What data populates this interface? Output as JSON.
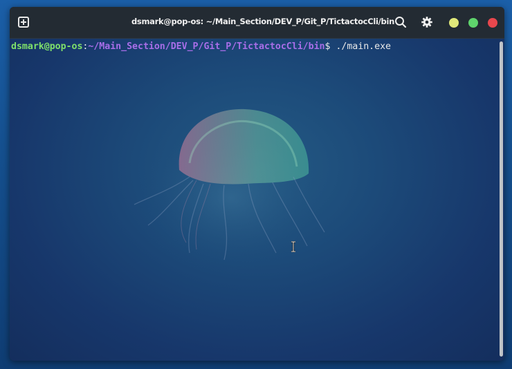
{
  "window": {
    "title": "dsmark@pop-os: ~/Main_Section/DEV_P/Git_P/TictactocCli/bin"
  },
  "terminal": {
    "prompt_user": "dsmark@pop-os",
    "prompt_sep": ":",
    "prompt_path": "~/Main_Section/DEV_P/Git_P/TictactocCli/bin",
    "prompt_symbol": "$",
    "command": "./main.exe"
  },
  "colors": {
    "prompt_user": "#7fe06a",
    "prompt_path": "#a86ee8",
    "minimize": "#e0e87a",
    "maximize": "#5fd46c",
    "close": "#e8474d"
  },
  "icons": [
    "new-tab-icon",
    "search-icon",
    "gear-icon",
    "minimize-icon",
    "maximize-icon",
    "close-icon",
    "text-cursor-icon"
  ]
}
